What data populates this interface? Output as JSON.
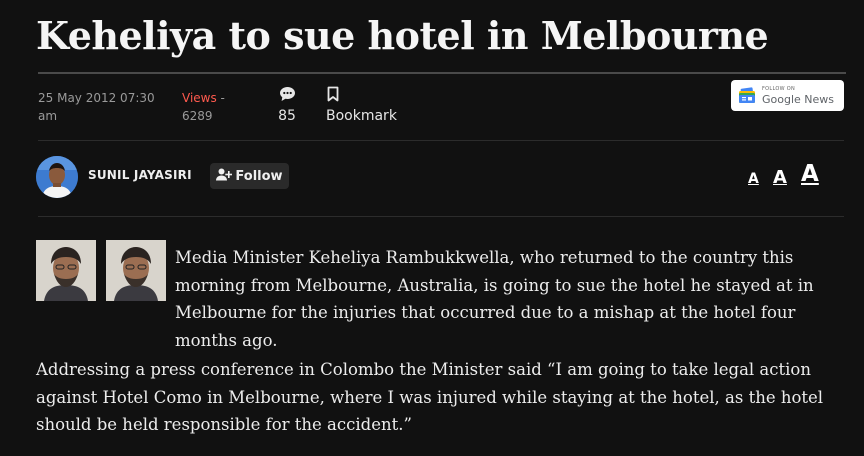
{
  "article": {
    "title": "Keheliya to sue hotel in Melbourne",
    "date": "25 May 2012 07:30 am",
    "views_label": "Views",
    "views_sep": " - ",
    "views_count": "6289",
    "comments_count": "85",
    "bookmark_label": "Bookmark",
    "author": "SUNIL JAYASIRI",
    "follow_label": "Follow",
    "paragraphs": [
      "Media Minister Keheliya Rambukkwella, who returned to the country this morning from Melbourne, Australia, is going to sue the hotel he stayed at in Melbourne for the injuries that occurred due to a mishap at the hotel four months ago.",
      "Addressing a press conference in Colombo the Minister said “I am going to take legal action against Hotel Como in Melbourne, where I was injured while staying at the hotel, as the hotel should be held responsible for the accident.”"
    ]
  },
  "google_news": {
    "follow_on": "FOLLOW ON",
    "brand": "Google News"
  },
  "font_size_controls": [
    "A",
    "A",
    "A"
  ],
  "colors": {
    "background": "#111111",
    "views_accent": "#ff5a4e",
    "text": "#ececec"
  },
  "icons": [
    "comment-icon",
    "bookmark-icon",
    "add-user-icon",
    "google-news-icon"
  ]
}
